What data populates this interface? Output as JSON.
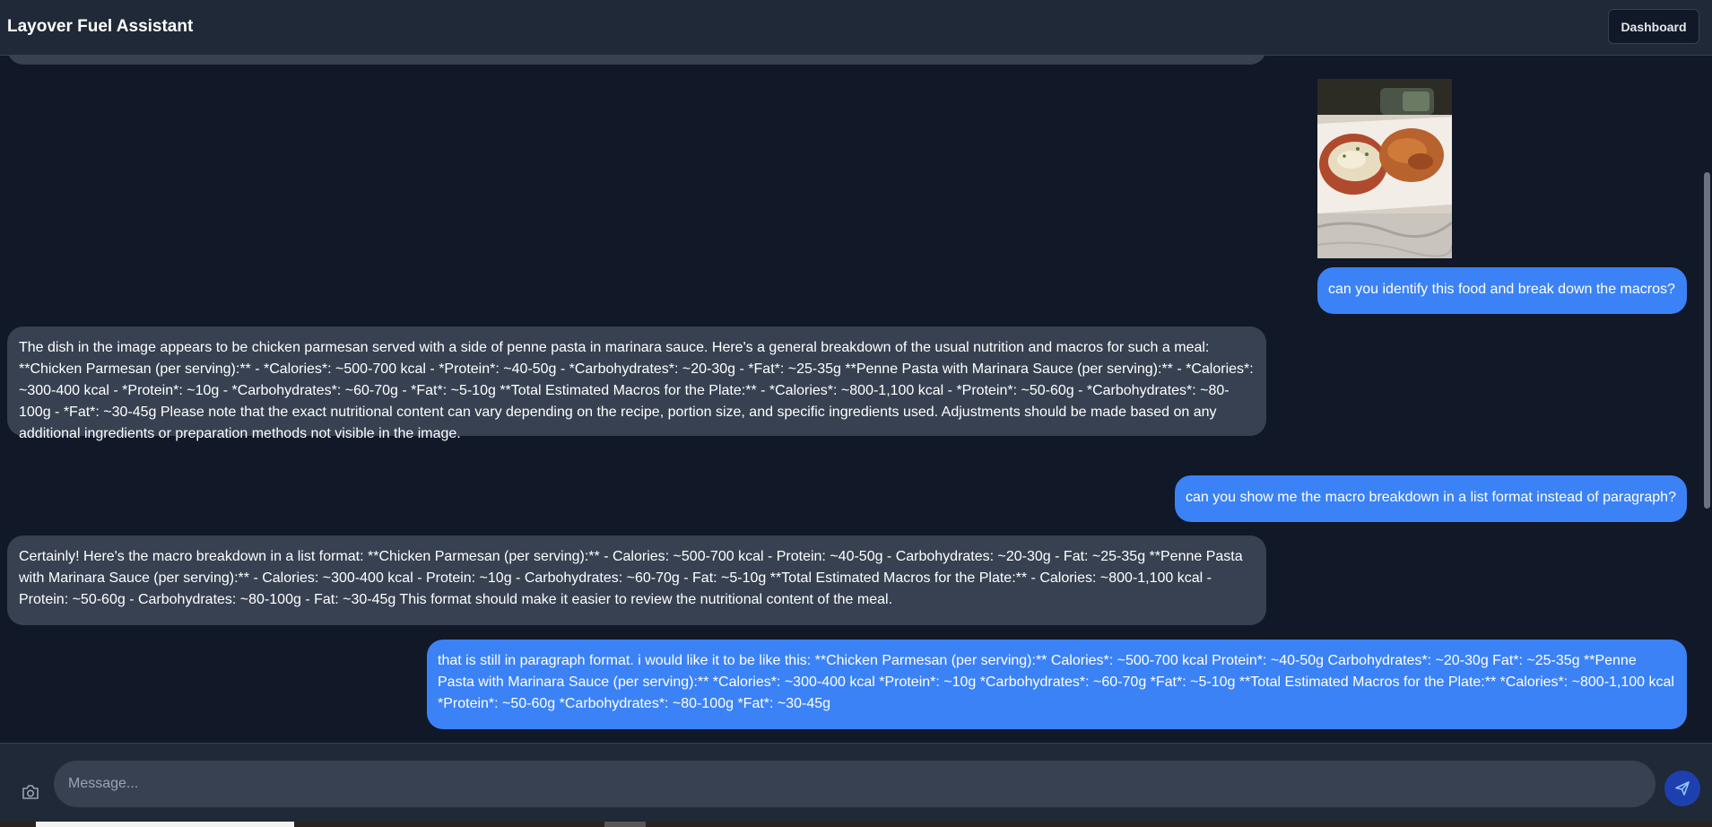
{
  "app": {
    "title": "Layover Fuel Assistant",
    "dashboard_label": "Dashboard"
  },
  "messages": [
    {
      "role": "user",
      "text": "can you identify this food and break down the macros?"
    },
    {
      "role": "assistant",
      "text": "The dish in the image appears to be chicken parmesan served with a side of penne pasta in marinara sauce. Here's a general breakdown of the usual nutrition and macros for such a meal: **Chicken Parmesan (per serving):** - *Calories*: ~500-700 kcal - *Protein*: ~40-50g - *Carbohydrates*: ~20-30g - *Fat*: ~25-35g **Penne Pasta with Marinara Sauce (per serving):** - *Calories*: ~300-400 kcal - *Protein*: ~10g - *Carbohydrates*: ~60-70g - *Fat*: ~5-10g **Total Estimated Macros for the Plate:** - *Calories*: ~800-1,100 kcal - *Protein*: ~50-60g - *Carbohydrates*: ~80-100g - *Fat*: ~30-45g Please note that the exact nutritional content can vary depending on the recipe, portion size, and specific ingredients used. Adjustments should be made based on any additional ingredients or preparation methods not visible in the image."
    },
    {
      "role": "user",
      "text": "can you show me the macro breakdown in a list format instead of paragraph?"
    },
    {
      "role": "assistant",
      "text": "Certainly! Here's the macro breakdown in a list format: **Chicken Parmesan (per serving):** - Calories: ~500-700 kcal - Protein: ~40-50g - Carbohydrates: ~20-30g - Fat: ~25-35g **Penne Pasta with Marinara Sauce (per serving):** - Calories: ~300-400 kcal - Protein: ~10g - Carbohydrates: ~60-70g - Fat: ~5-10g **Total Estimated Macros for the Plate:** - Calories: ~800-1,100 kcal - Protein: ~50-60g - Carbohydrates: ~80-100g - Fat: ~30-45g This format should make it easier to review the nutritional content of the meal."
    },
    {
      "role": "user",
      "text": "that is still in paragraph format. i would like it to be like this: **Chicken Parmesan (per serving):** Calories*: ~500-700 kcal Protein*: ~40-50g Carbohydrates*: ~20-30g Fat*: ~25-35g **Penne Pasta with Marinara Sauce (per serving):** *Calories*: ~300-400 kcal *Protein*: ~10g *Carbohydrates*: ~60-70g *Fat*: ~5-10g **Total Estimated Macros for the Plate:** *Calories*: ~800-1,100 kcal *Protein*: ~50-60g *Carbohydrates*: ~80-100g *Fat*: ~30-45g"
    }
  ],
  "composer": {
    "placeholder": "Message...",
    "camera_icon": "camera-icon",
    "send_icon": "send-icon"
  },
  "colors": {
    "background": "#111827",
    "surface": "#1f2937",
    "assistant_bubble": "#374151",
    "user_bubble": "#3b82f6",
    "send_button": "#1e40af"
  }
}
